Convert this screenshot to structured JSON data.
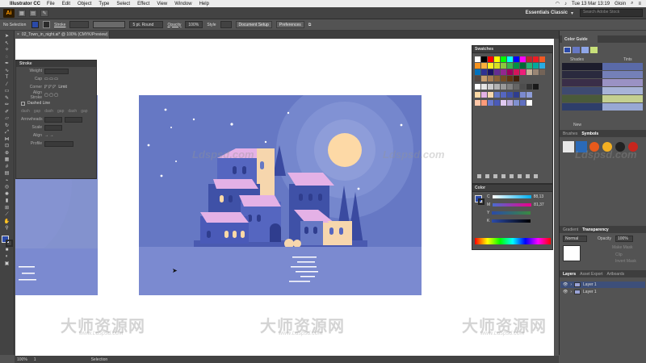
{
  "menubar": {
    "app_name": "Illustrator CC",
    "items": [
      "File",
      "Edit",
      "Object",
      "Type",
      "Select",
      "Effect",
      "View",
      "Window",
      "Help"
    ],
    "clock": "Tue 13 Mar 13:19",
    "user": "Gloin"
  },
  "appbar": {
    "logo": "Ai",
    "workspace": "Essentials Classic",
    "search_placeholder": "Search Adobe Stock"
  },
  "controlbar": {
    "selection_status": "No Selection",
    "stroke_label": "Stroke",
    "brush_label": "5 pt. Round",
    "opacity_label": "Opacity",
    "opacity_value": "100%",
    "style_label": "Style",
    "doc_setup_label": "Document Setup",
    "preferences_label": "Preferences",
    "fill_color": "#2b4aa8",
    "stroke_color": "#2b2b2b"
  },
  "document": {
    "tab_title": "02_Town_in_night.ai* @ 100% (CMYK/Preview)"
  },
  "stroke_panel": {
    "title": "Stroke",
    "weight_label": "Weight",
    "cap_label": "Cap",
    "corner_label": "Corner",
    "limit_label": "Limit",
    "align_label": "Align Stroke",
    "dashed_label": "Dashed Line",
    "dash_labels": [
      "dash",
      "gap",
      "dash",
      "gap",
      "dash",
      "gap"
    ],
    "arrowheads_label": "Arrowheads",
    "scale_label": "Scale",
    "align2_label": "Align",
    "profile_label": "Profile"
  },
  "swatches_panel": {
    "title": "Swatches"
  },
  "color_panel": {
    "title": "Color",
    "channels": [
      {
        "label": "C",
        "value": "88,13"
      },
      {
        "label": "M",
        "value": "81,37"
      },
      {
        "label": "Y",
        "value": ""
      },
      {
        "label": "K",
        "value": ""
      }
    ]
  },
  "color_guide": {
    "title": "Color Guide",
    "shades_label": "Shades",
    "tints_label": "Tints",
    "new_label": "New"
  },
  "brushes_panel": {
    "tabs": [
      "Brushes",
      "Symbols"
    ]
  },
  "transparency_panel": {
    "tabs": [
      "Gradient",
      "Transparency"
    ],
    "blend_mode": "Normal",
    "opacity_label": "Opacity",
    "opacity_value": "100%",
    "make_mask": "Make Mask",
    "clip": "Clip",
    "invert_mask": "Invert Mask"
  },
  "layers_panel": {
    "tabs": [
      "Layers",
      "Asset Export",
      "Artboards"
    ],
    "layers": [
      "Layer 1",
      "Layer 1"
    ]
  },
  "statusbar": {
    "zoom": "100%",
    "page": "1",
    "mode": "Selection"
  },
  "watermarks": {
    "latin": "Ldspsd.com",
    "cn": "大师资源网",
    "cn_sub": "www.Ldspsd.com"
  },
  "palette": {
    "sky": "#6678c4",
    "moon": "#fdd9a6",
    "house_dark": "#3f51a7",
    "house_mid": "#5566c0",
    "roof_pink": "#e4b1e6",
    "house_cream": "#f6d6ad",
    "water": "#7b8ad0"
  }
}
